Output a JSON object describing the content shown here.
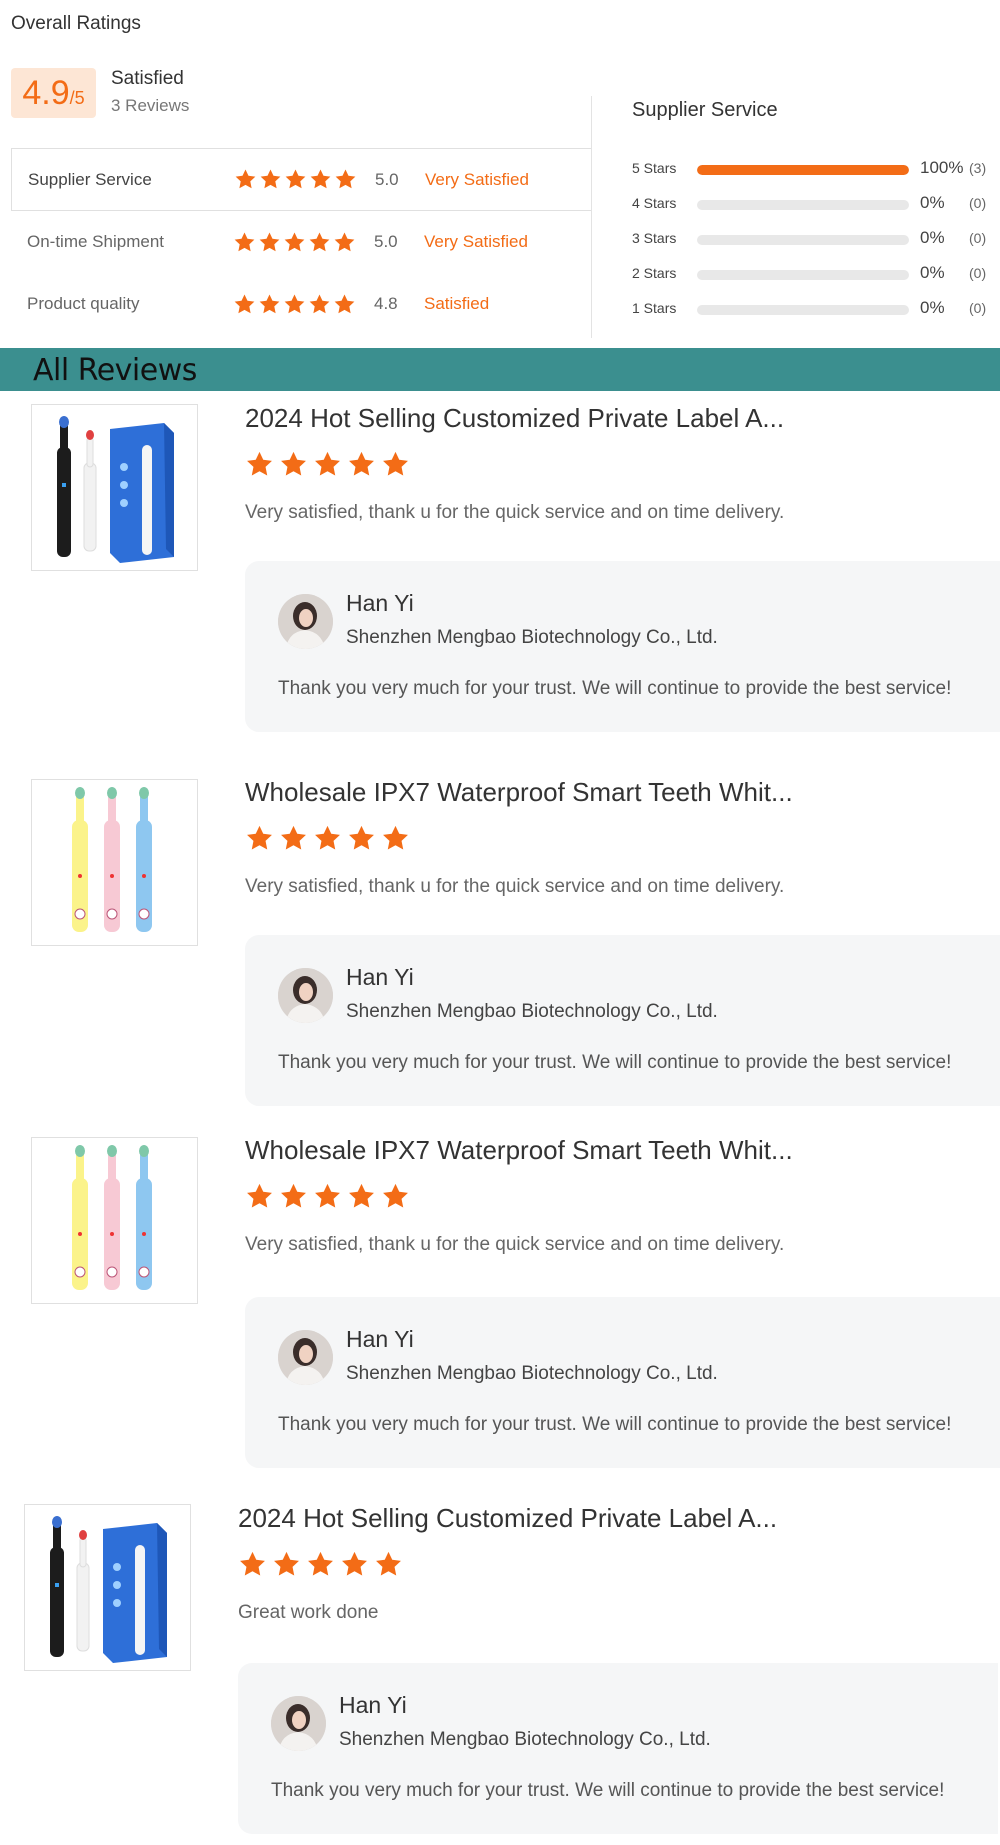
{
  "overall": {
    "title": "Overall Ratings",
    "score": "4.9",
    "score_max": "/5",
    "satisfaction": "Satisfied",
    "reviews_count": "3 Reviews",
    "categories": [
      {
        "name": "Supplier Service",
        "score": "5.0",
        "desc": "Very Satisfied",
        "stars": 5
      },
      {
        "name": "On-time Shipment",
        "score": "5.0",
        "desc": "Very Satisfied",
        "stars": 5
      },
      {
        "name": "Product quality",
        "score": "4.8",
        "desc": "Satisfied",
        "stars": 5
      }
    ]
  },
  "distribution": {
    "title": "Supplier Service",
    "rows": [
      {
        "label": "5  Stars",
        "fraction": 1.0,
        "pct": "100%",
        "count": "(3)"
      },
      {
        "label": "4  Stars",
        "fraction": 0.0,
        "pct": "0%",
        "count": "(0)"
      },
      {
        "label": "3  Stars",
        "fraction": 0.0,
        "pct": "0%",
        "count": "(0)"
      },
      {
        "label": "2  Stars",
        "fraction": 0.0,
        "pct": "0%",
        "count": "(0)"
      },
      {
        "label": "1  Stars",
        "fraction": 0.0,
        "pct": "0%",
        "count": "(0)"
      }
    ]
  },
  "reviews_header": "All Reviews",
  "reviews": [
    {
      "product_title": "2024 Hot Selling Customized Private Label A...",
      "rating": 5,
      "text": "Very satisfied, thank u for the quick service and on time delivery.",
      "thumb_variant": "blue-box",
      "reply": {
        "name": "Han Yi",
        "company": "Shenzhen Mengbao Biotechnology Co., Ltd.",
        "text": "Thank you very much for your trust. We will continue to provide the best service!"
      }
    },
    {
      "product_title": "Wholesale IPX7 Waterproof Smart Teeth Whit...",
      "rating": 5,
      "text": "Very satisfied, thank u for the quick service and on time delivery.",
      "thumb_variant": "pastel",
      "reply": {
        "name": "Han Yi",
        "company": "Shenzhen Mengbao Biotechnology Co., Ltd.",
        "text": "Thank you very much for your trust. We will continue to provide the best service!"
      }
    },
    {
      "product_title": "Wholesale IPX7 Waterproof Smart Teeth Whit...",
      "rating": 5,
      "text": "Very satisfied, thank u for the quick service and on time delivery.",
      "thumb_variant": "pastel",
      "reply": {
        "name": "Han Yi",
        "company": "Shenzhen Mengbao Biotechnology Co., Ltd.",
        "text": "Thank you very much for your trust. We will continue to provide the best service!"
      }
    },
    {
      "product_title": "2024 Hot Selling Customized Private Label A...",
      "rating": 5,
      "text": "Great work done",
      "thumb_variant": "blue-box",
      "reply": {
        "name": "Han Yi",
        "company": "Shenzhen Mengbao Biotechnology Co., Ltd.",
        "text": "Thank you very much for your trust. We will continue to provide the best service!"
      }
    }
  ],
  "colors": {
    "accent": "#f36c16",
    "header_bg": "#3b8f8f",
    "score_bg": "#fde6d5"
  },
  "icons": {
    "star": "star-icon",
    "avatar": "avatar"
  }
}
